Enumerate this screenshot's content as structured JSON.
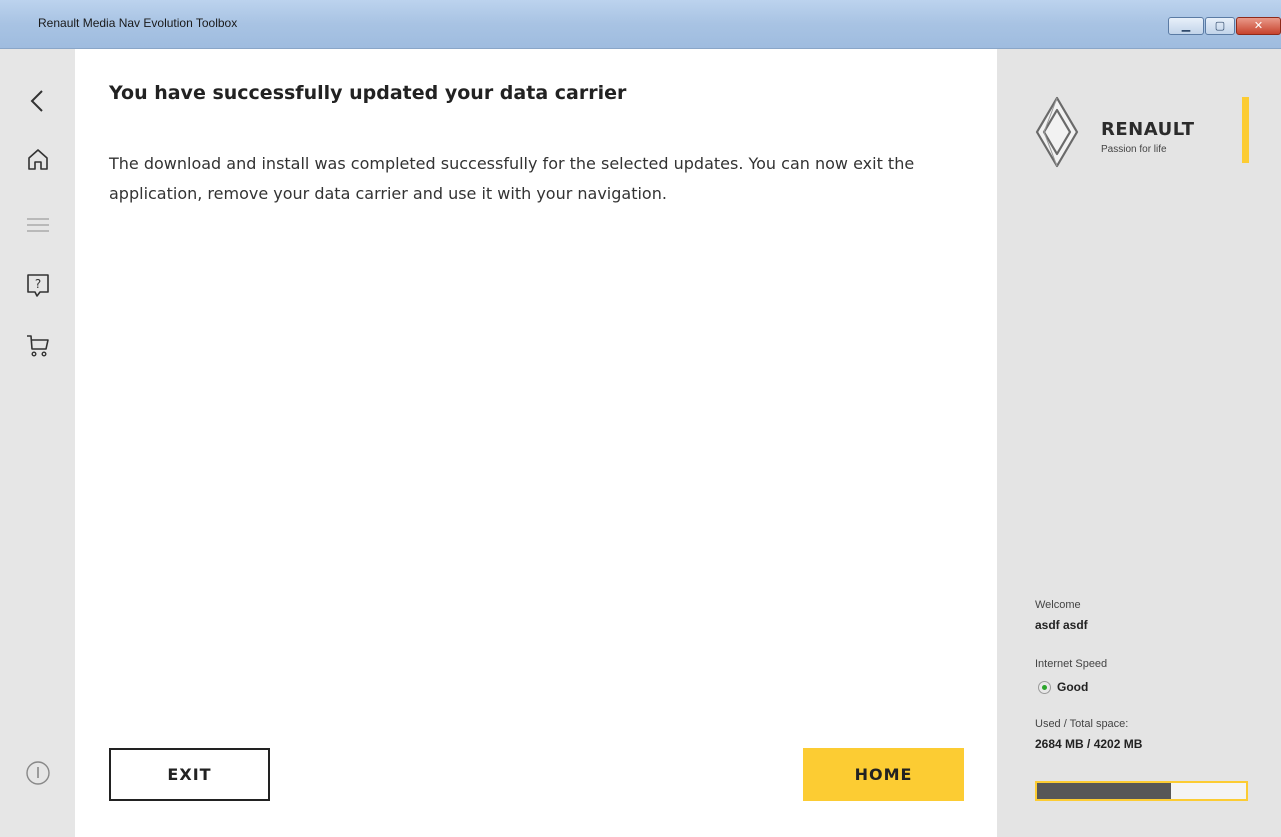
{
  "window": {
    "title": "Renault Media Nav Evolution Toolbox",
    "controls": {
      "minimize": "▁",
      "maximize": "▢",
      "close": "✕"
    }
  },
  "nav": {
    "items": [
      {
        "name": "back",
        "icon": "chevron-left-icon"
      },
      {
        "name": "home",
        "icon": "home-icon"
      },
      {
        "name": "menu",
        "icon": "menu-icon"
      },
      {
        "name": "help",
        "icon": "help-icon"
      },
      {
        "name": "cart",
        "icon": "cart-icon"
      },
      {
        "name": "info",
        "icon": "info-icon"
      }
    ]
  },
  "main": {
    "heading": "You have successfully updated your data carrier",
    "body": "The download and install was completed successfully for the selected updates. You can now exit the application, remove your data carrier and use it with your navigation.",
    "exit_label": "EXIT",
    "home_label": "HOME"
  },
  "sidebar": {
    "brand_name": "RENAULT",
    "brand_tagline": "Passion for life",
    "welcome_label": "Welcome",
    "user_name": "asdf asdf",
    "speed_label": "Internet Speed",
    "speed_value": "Good",
    "space_label": "Used / Total space:",
    "space_value": "2684 MB / 4202 MB",
    "space_used_fraction": 0.639
  },
  "colors": {
    "accent": "#fccc33",
    "speed_good": "#2aa52a",
    "nav_background": "#e6e6e6",
    "side_background": "#e4e4e4",
    "used_space": "#575757"
  }
}
